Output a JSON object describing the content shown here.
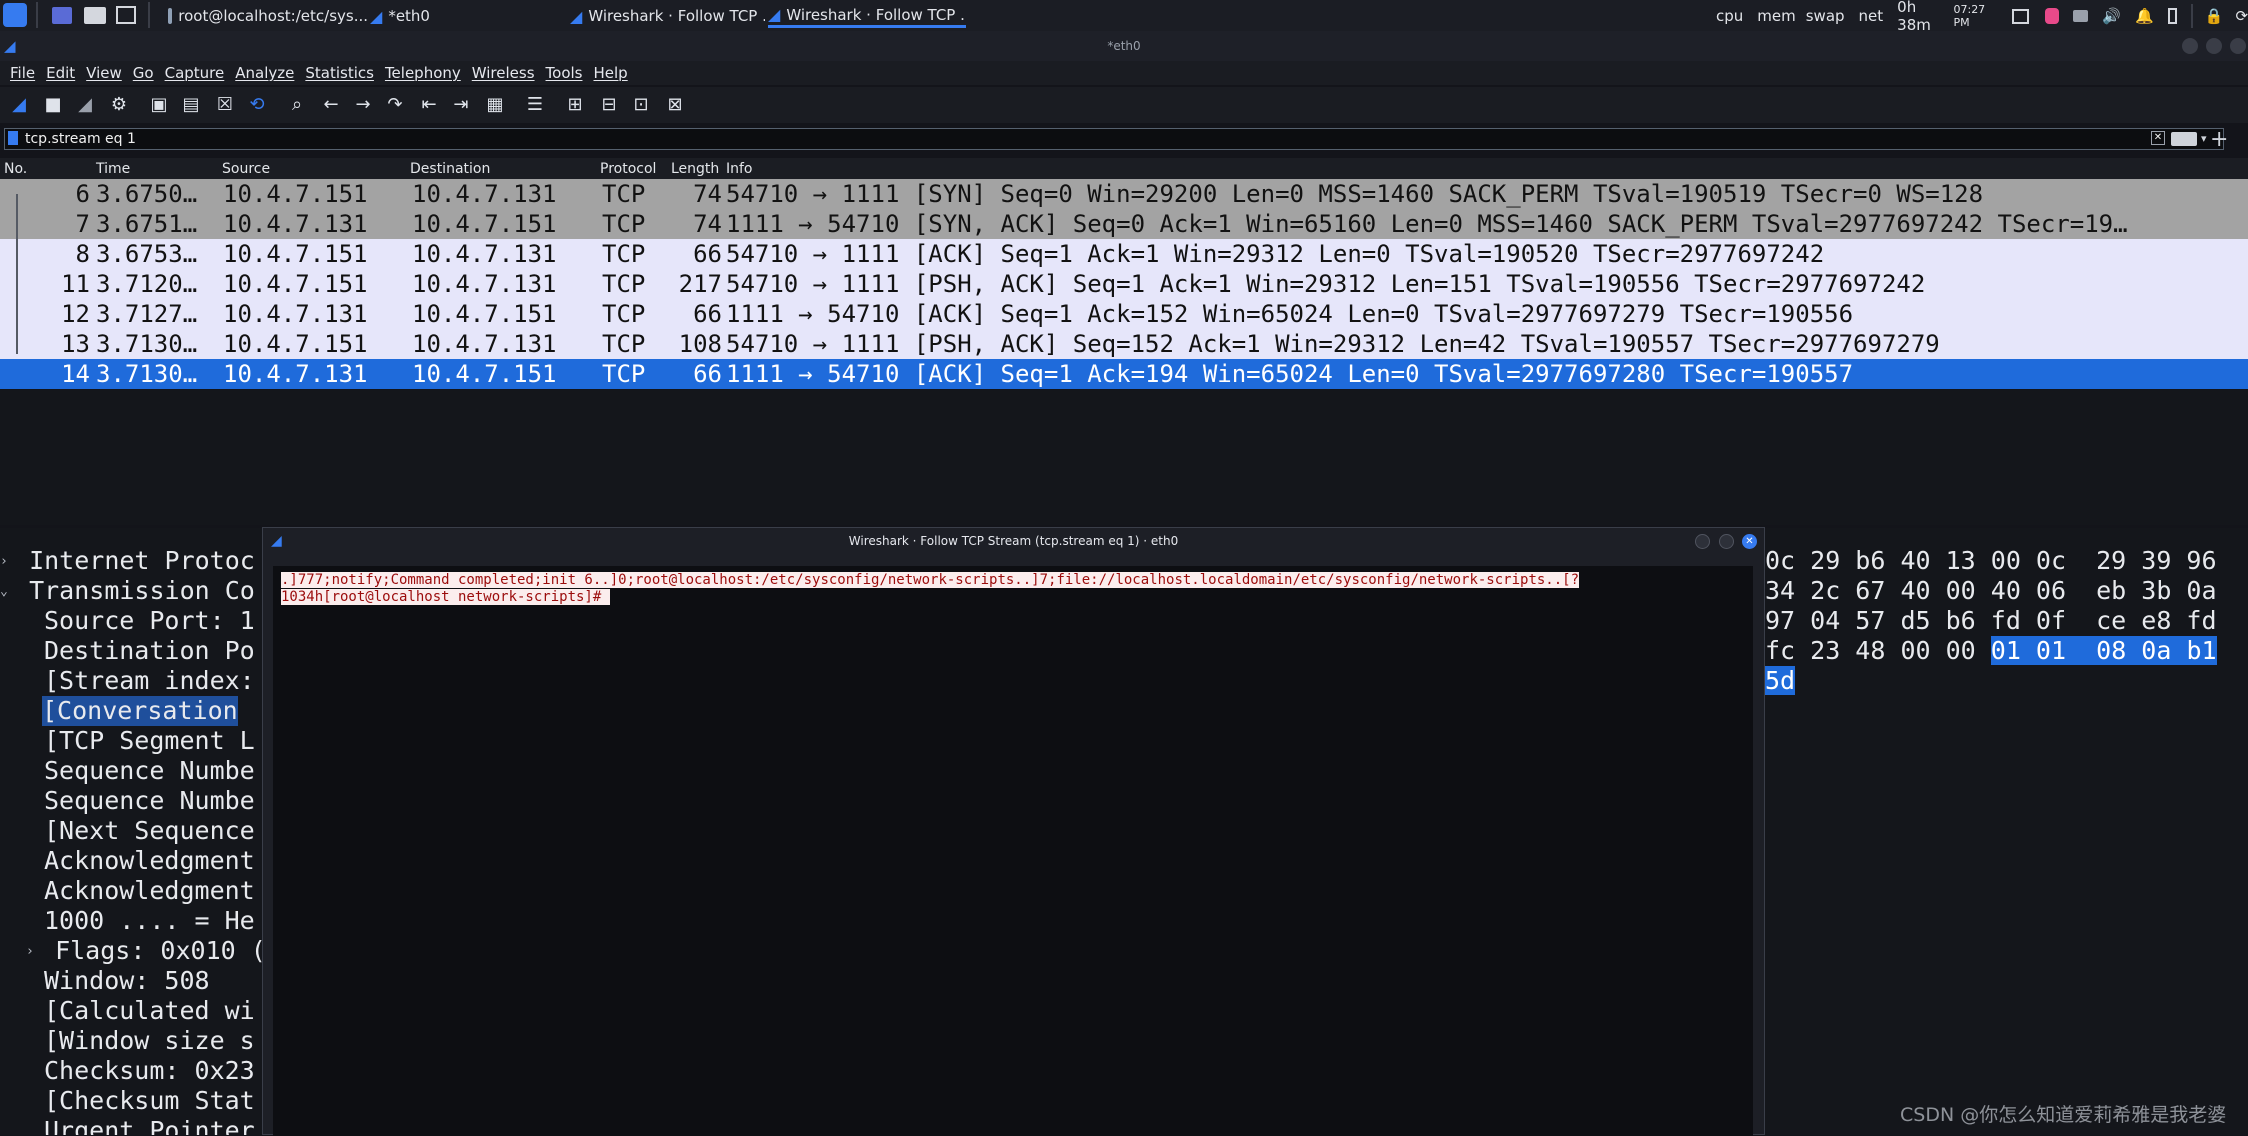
{
  "taskbar": {
    "tasks": [
      {
        "label": "root@localhost:/etc/sys..."
      },
      {
        "label": "*eth0"
      },
      {
        "label": "Wireshark · Follow TCP ..."
      },
      {
        "label": "Wireshark · Follow TCP ..."
      }
    ],
    "sys": {
      "cpu": "cpu",
      "mem": "mem",
      "swap": "swap",
      "net": "net",
      "uptime": "0h 38m",
      "clock": "07:27 PM"
    }
  },
  "window": {
    "title": "*eth0"
  },
  "menu": [
    "File",
    "Edit",
    "View",
    "Go",
    "Capture",
    "Analyze",
    "Statistics",
    "Telephony",
    "Wireless",
    "Tools",
    "Help"
  ],
  "filter": {
    "value": "tcp.stream eq 1"
  },
  "packet_list": {
    "columns": [
      "No.",
      "Time",
      "Source",
      "Destination",
      "Protocol",
      "Length",
      "Info"
    ],
    "rows": [
      {
        "no": "6",
        "time": "3.6750…",
        "src": "10.4.7.151",
        "dst": "10.4.7.131",
        "proto": "TCP",
        "len": "74",
        "info": "54710 → 1111 [SYN] Seq=0 Win=29200 Len=0 MSS=1460 SACK_PERM TSval=190519 TSecr=0 WS=128"
      },
      {
        "no": "7",
        "time": "3.6751…",
        "src": "10.4.7.131",
        "dst": "10.4.7.151",
        "proto": "TCP",
        "len": "74",
        "info": "1111 → 54710 [SYN, ACK] Seq=0 Ack=1 Win=65160 Len=0 MSS=1460 SACK_PERM TSval=2977697242 TSecr=19…"
      },
      {
        "no": "8",
        "time": "3.6753…",
        "src": "10.4.7.151",
        "dst": "10.4.7.131",
        "proto": "TCP",
        "len": "66",
        "info": "54710 → 1111 [ACK] Seq=1 Ack=1 Win=29312 Len=0 TSval=190520 TSecr=2977697242"
      },
      {
        "no": "11",
        "time": "3.7120…",
        "src": "10.4.7.151",
        "dst": "10.4.7.131",
        "proto": "TCP",
        "len": "217",
        "info": "54710 → 1111 [PSH, ACK] Seq=1 Ack=1 Win=29312 Len=151 TSval=190556 TSecr=2977697242"
      },
      {
        "no": "12",
        "time": "3.7127…",
        "src": "10.4.7.131",
        "dst": "10.4.7.151",
        "proto": "TCP",
        "len": "66",
        "info": "1111 → 54710 [ACK] Seq=1 Ack=152 Win=65024 Len=0 TSval=2977697279 TSecr=190556"
      },
      {
        "no": "13",
        "time": "3.7130…",
        "src": "10.4.7.151",
        "dst": "10.4.7.131",
        "proto": "TCP",
        "len": "108",
        "info": "54710 → 1111 [PSH, ACK] Seq=152 Ack=1 Win=29312 Len=42 TSval=190557 TSecr=2977697279"
      },
      {
        "no": "14",
        "time": "3.7130…",
        "src": "10.4.7.131",
        "dst": "10.4.7.151",
        "proto": "TCP",
        "len": "66",
        "info": "1111 → 54710 [ACK] Seq=1 Ack=194 Win=65024 Len=0 TSval=2977697280 TSecr=190557"
      }
    ]
  },
  "details": [
    "Internet Protoc",
    "Transmission Co",
    "Source Port: 1",
    "Destination Po",
    "[Stream index:",
    "[Conversation ",
    "[TCP Segment L",
    "Sequence Numbe",
    "Sequence Numbe",
    "[Next Sequence",
    "Acknowledgment",
    "Acknowledgment",
    "1000 .... = He",
    "Flags: 0x010 (",
    "Window: 508",
    "[Calculated wi",
    "[Window size s",
    "Checksum: 0x23",
    "[Checksum Stat",
    "Urgent Pointer"
  ],
  "bytes": {
    "line1": "0c 29 b6 40 13 00 0c  29 39 96",
    "line2": "34 2c 67 40 00 40 06  eb 3b 0a",
    "line3": "97 04 57 d5 b6 fd 0f  ce e8 fd",
    "line4a": "fc 23 48 00 00 ",
    "line4b": "01 01  08 0a b1",
    "line5": "5d"
  },
  "dialog": {
    "title": "Wireshark · Follow TCP Stream (tcp.stream eq 1) · eth0",
    "line1": ".]777;notify;Command completed;init 6..]0;root@localhost:/etc/sysconfig/network-scripts..]7;file://localhost.localdomain/etc/sysconfig/network-scripts..[?",
    "line2": "1034h[root@localhost network-scripts]# "
  },
  "watermark": "CSDN @你怎么知道爱莉希雅是我老婆",
  "colors": {
    "selected": "#1f6bdb",
    "gray_row": "#a3a3a3",
    "lav_row": "#e6e6fa",
    "stream_text": "#9b0c0c"
  }
}
